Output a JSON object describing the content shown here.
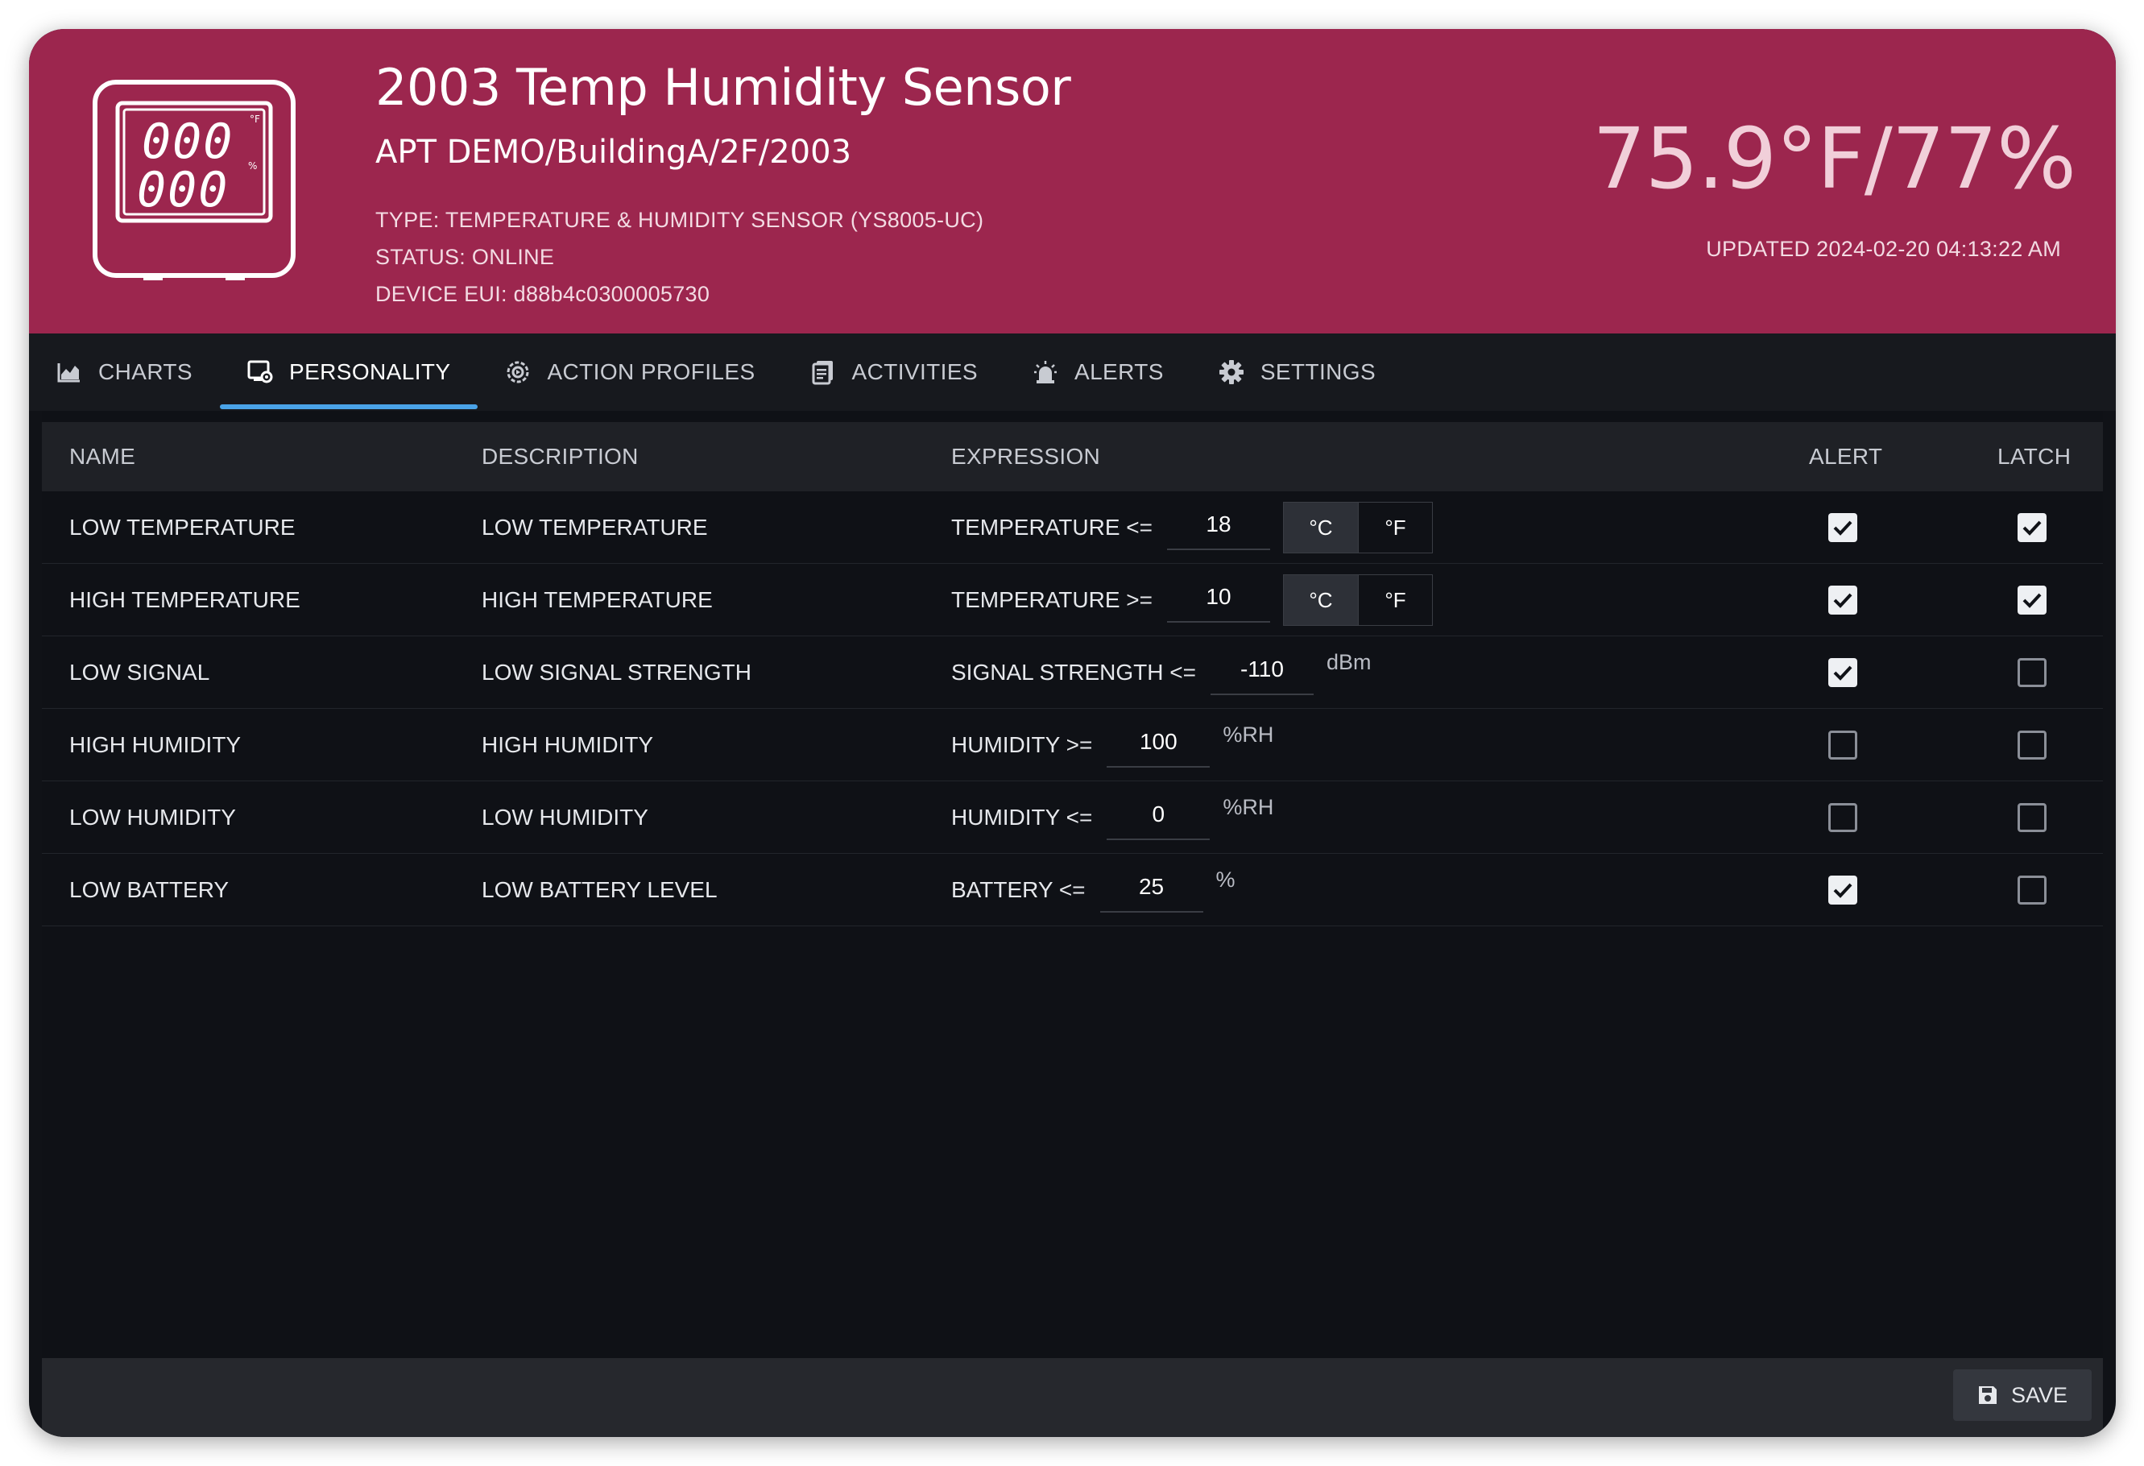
{
  "header": {
    "title": "2003 Temp Humidity Sensor",
    "path": "APT DEMO/BuildingA/2F/2003",
    "type": "TYPE:  TEMPERATURE & HUMIDITY SENSOR (YS8005-UC)",
    "status": "STATUS:  ONLINE",
    "eui": "DEVICE EUI: d88b4c0300005730",
    "reading": "75.9°F/77%",
    "updated": "UPDATED 2024-02-20 04:13:22 AM",
    "accent_color": "#9c264e"
  },
  "tabs": [
    {
      "label": "CHARTS",
      "icon": "chart-icon"
    },
    {
      "label": "PERSONALITY",
      "icon": "personality-icon",
      "active": true
    },
    {
      "label": "ACTION PROFILES",
      "icon": "action-profiles-icon"
    },
    {
      "label": "ACTIVITIES",
      "icon": "activities-icon"
    },
    {
      "label": "ALERTS",
      "icon": "alarm-icon"
    },
    {
      "label": "SETTINGS",
      "icon": "gear-icon"
    }
  ],
  "table": {
    "columns": [
      "NAME",
      "DESCRIPTION",
      "EXPRESSION",
      "ALERT",
      "LATCH"
    ],
    "rows": [
      {
        "name": "LOW TEMPERATURE",
        "description": "LOW TEMPERATURE",
        "expr_label": "TEMPERATURE <=",
        "value": "18",
        "units": [
          "°C",
          "°F"
        ],
        "unit_selected": "°C",
        "alert": true,
        "latch": true
      },
      {
        "name": "HIGH TEMPERATURE",
        "description": "HIGH TEMPERATURE",
        "expr_label": "TEMPERATURE >=",
        "value": "10",
        "units": [
          "°C",
          "°F"
        ],
        "unit_selected": "°C",
        "alert": true,
        "latch": true
      },
      {
        "name": "LOW SIGNAL",
        "description": "LOW SIGNAL STRENGTH",
        "expr_label": "SIGNAL STRENGTH <=",
        "value": "-110",
        "unit": "dBm",
        "alert": true,
        "latch": false
      },
      {
        "name": "HIGH HUMIDITY",
        "description": "HIGH HUMIDITY",
        "expr_label": "HUMIDITY >=",
        "value": "100",
        "unit": "%RH",
        "alert": false,
        "latch": false
      },
      {
        "name": "LOW HUMIDITY",
        "description": "LOW HUMIDITY",
        "expr_label": "HUMIDITY <=",
        "value": "0",
        "unit": "%RH",
        "alert": false,
        "latch": false
      },
      {
        "name": "LOW BATTERY",
        "description": "LOW BATTERY LEVEL",
        "expr_label": "BATTERY <=",
        "value": "25",
        "unit": "%",
        "alert": true,
        "latch": false
      }
    ]
  },
  "footer": {
    "save_label": "SAVE",
    "save_icon": "floppy-icon"
  }
}
